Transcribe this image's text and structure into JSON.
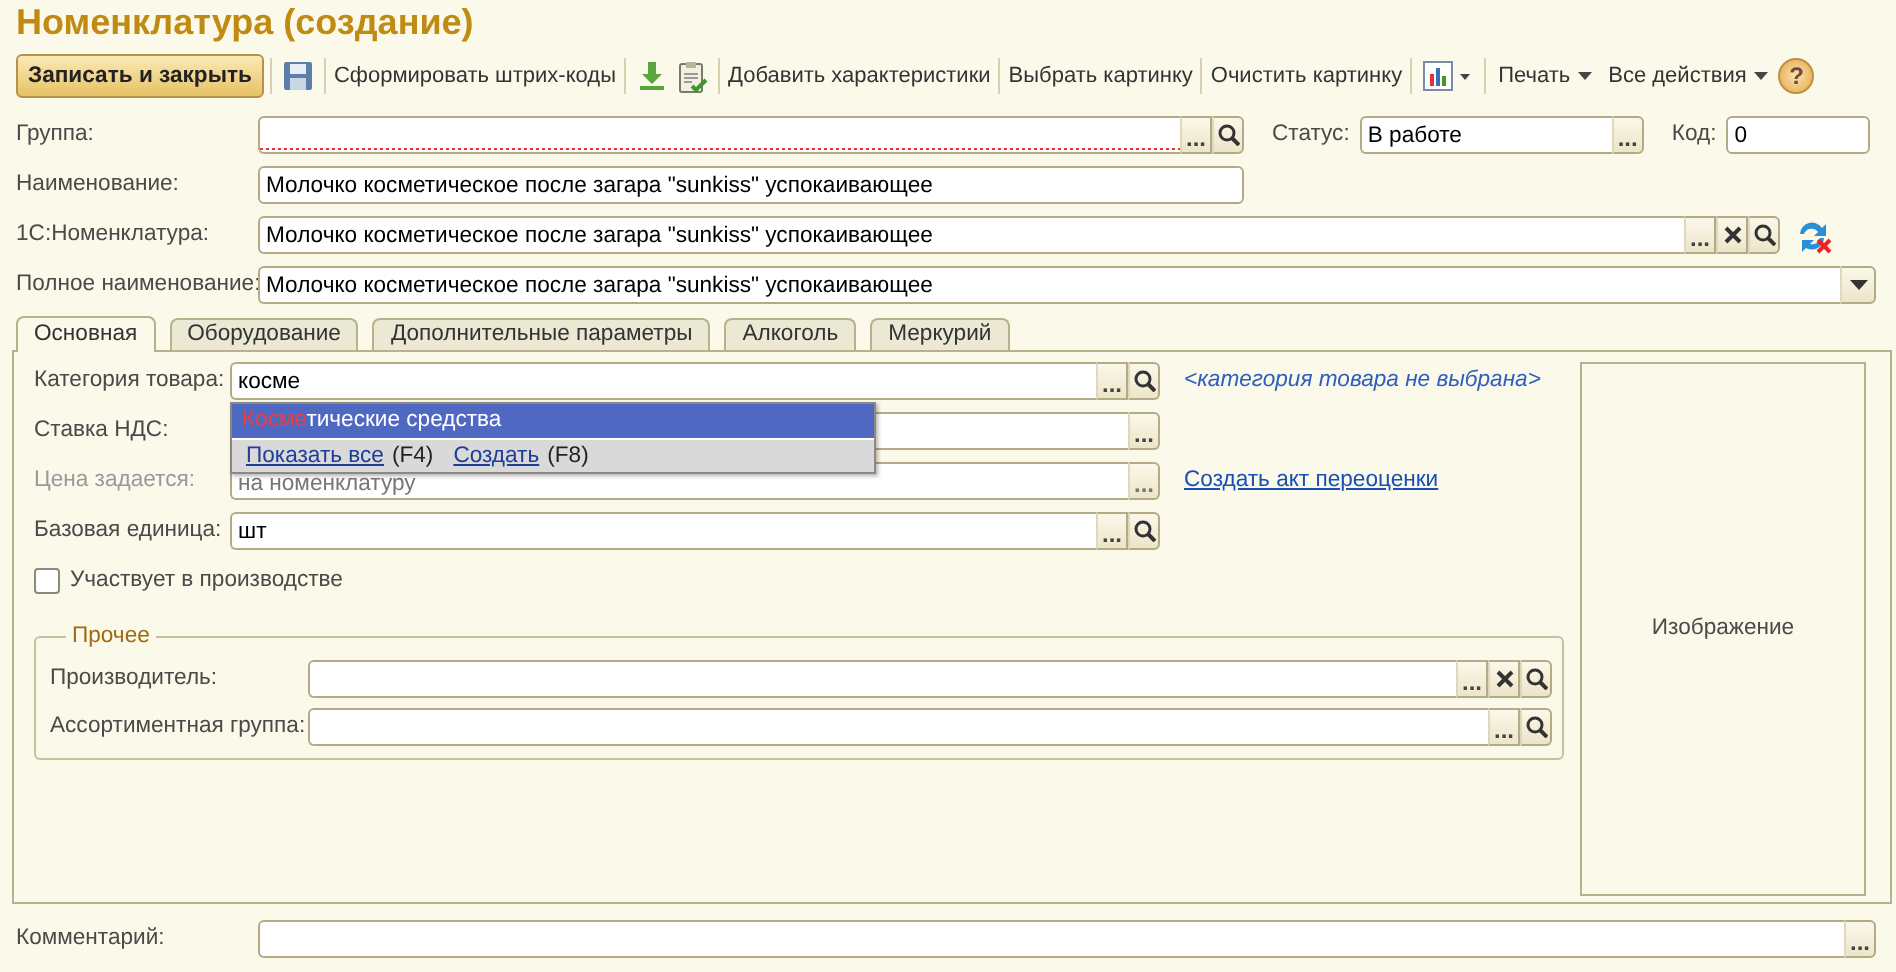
{
  "title": "Номенклатура (создание)",
  "toolbar": [
    {
      "kind": "primary",
      "label": "Записать и закрыть"
    },
    {
      "kind": "button",
      "label": "Сформировать штрих-коды"
    },
    {
      "kind": "button",
      "label": "Добавить характеристики"
    },
    {
      "kind": "button",
      "label": "Выбрать картинку"
    },
    {
      "kind": "button",
      "label": "Очистить картинку"
    },
    {
      "kind": "menu",
      "label": "Печать"
    },
    {
      "kind": "menu",
      "label": "Все действия"
    },
    {
      "kind": "help",
      "label": "?"
    }
  ],
  "header_rows": [
    [
      {
        "label": "Группа:",
        "required": true,
        "buttons": [
          {
            "kind": "select",
            "text": "..."
          },
          {
            "kind": "search"
          }
        ]
      },
      {
        "label": "Статус:",
        "value": "В работе",
        "buttons": [
          {
            "kind": "select",
            "text": "..."
          }
        ]
      },
      {
        "label": "Код:",
        "value": "0"
      }
    ],
    [
      {
        "label": "Наименование:",
        "value": "Молочко косметическое после загара \"sunkiss\" успокаивающее"
      }
    ],
    [
      {
        "label": "1С:Номенклатура:",
        "value": "Молочко косметическое после загара \"sunkiss\" успокаивающее",
        "buttons": [
          {
            "kind": "select",
            "text": "..."
          },
          {
            "kind": "clear"
          },
          {
            "kind": "search"
          }
        ]
      }
    ],
    [
      {
        "label": "Полное наименование:",
        "value": "Молочко косметическое после загара \"sunkiss\" успокаивающее",
        "buttons": [
          {
            "kind": "dropdown"
          }
        ]
      }
    ]
  ],
  "tabs": [
    {
      "label": "Основная",
      "selected": true
    },
    {
      "label": "Оборудование",
      "selected": false
    },
    {
      "label": "Дополнительные параметры",
      "selected": false
    },
    {
      "label": "Алкоголь",
      "selected": false
    },
    {
      "label": "Меркурий",
      "selected": false
    }
  ],
  "main_fields": [
    {
      "label": "Категория товара:",
      "value": "косме",
      "buttons": [
        {
          "kind": "select",
          "text": "..."
        },
        {
          "kind": "search"
        }
      ],
      "hint": "<категория товара не выбрана>"
    },
    {
      "label": "Ставка НДС:",
      "buttons": [
        {
          "kind": "select",
          "text": "..."
        }
      ]
    },
    {
      "label": "Цена задается:",
      "value": "на номенклатуру",
      "disabled": true,
      "buttons": [
        {
          "kind": "select",
          "text": "..."
        }
      ],
      "link": "Создать акт переоценки"
    },
    {
      "label": "Базовая единица:",
      "value": "шт",
      "buttons": [
        {
          "kind": "select",
          "text": "..."
        },
        {
          "kind": "search"
        }
      ]
    }
  ],
  "production_checkbox": {
    "label": "Участвует в производстве",
    "checked": false
  },
  "other_group": {
    "title": "Прочее",
    "fields": [
      {
        "label": "Производитель:",
        "buttons": [
          {
            "kind": "select",
            "text": "..."
          },
          {
            "kind": "clear"
          },
          {
            "kind": "search"
          }
        ]
      },
      {
        "label": "Ассортиментная группа:",
        "buttons": [
          {
            "kind": "select",
            "text": "..."
          },
          {
            "kind": "search"
          }
        ]
      }
    ]
  },
  "image_panel": {
    "label": "Изображение"
  },
  "autocomplete": {
    "items": [
      {
        "match": "Косме",
        "rest": "тические средства",
        "selected": true
      }
    ],
    "actions": [
      {
        "label": "Показать все",
        "key": "(F4)"
      },
      {
        "label": "Создать",
        "key": "(F8)"
      }
    ]
  },
  "comment": {
    "label": "Комментарий:",
    "buttons": [
      {
        "kind": "select",
        "text": "..."
      }
    ]
  }
}
